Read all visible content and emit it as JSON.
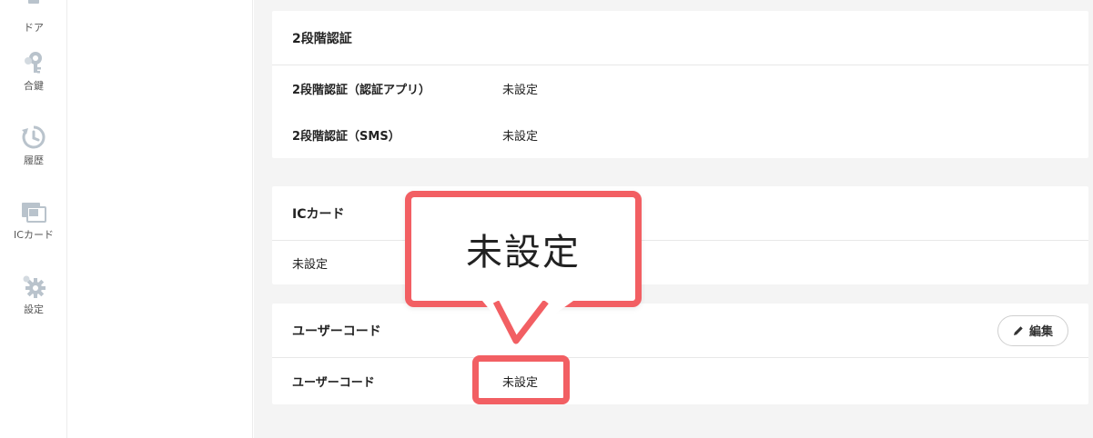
{
  "colors": {
    "accent_red": "#f25f63",
    "nav_icon": "#b9c3cc",
    "page_bg": "#f4f4f4"
  },
  "nav": {
    "items": [
      {
        "id": "door",
        "icon": "door-icon",
        "label": "ドア"
      },
      {
        "id": "key",
        "icon": "key-icon",
        "label": "合鍵"
      },
      {
        "id": "history",
        "icon": "history-icon",
        "label": "履歴"
      },
      {
        "id": "iccard",
        "icon": "ic-card-icon",
        "label": "ICカード"
      },
      {
        "id": "settings",
        "icon": "gear-icon",
        "label": "設定"
      }
    ]
  },
  "two_factor": {
    "title": "2段階認証",
    "rows": [
      {
        "label": "2段階認証（認証アプリ）",
        "value": "未設定"
      },
      {
        "label": "2段階認証（SMS）",
        "value": "未設定"
      }
    ]
  },
  "ic_card": {
    "title": "ICカード",
    "value": "未設定"
  },
  "user_code": {
    "title": "ユーザーコード",
    "edit_label": "編集",
    "edit_icon": "pencil-icon",
    "rows": [
      {
        "label": "ユーザーコード",
        "value": "未設定"
      }
    ]
  },
  "callout": {
    "text": "未設定"
  }
}
